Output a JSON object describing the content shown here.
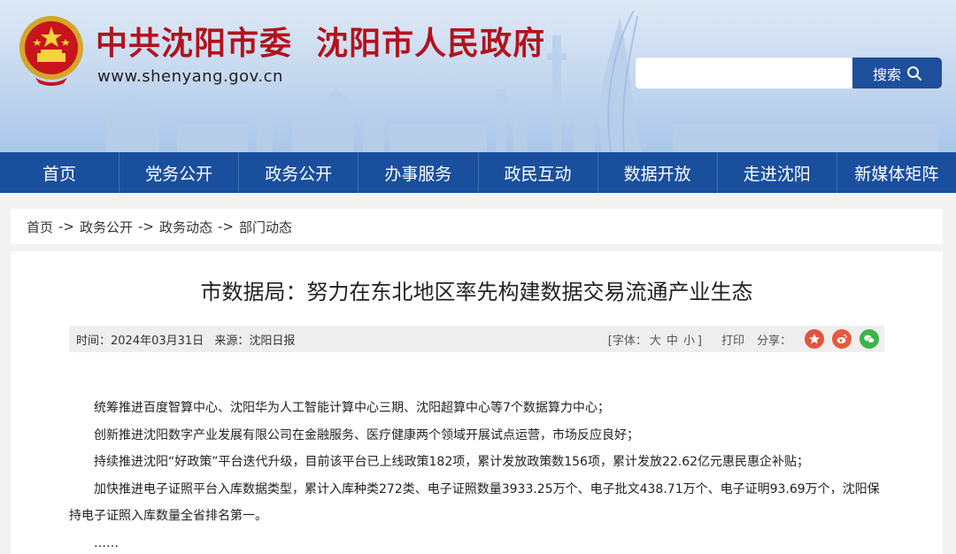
{
  "header": {
    "title": "中共沈阳市委  沈阳市人民政府",
    "url": "www.shenyang.gov.cn",
    "search_placeholder": "",
    "search_button": "搜索",
    "colors": {
      "title": "#b3121c",
      "nav": "#1a4f9d",
      "search_button": "#1d4f9c"
    }
  },
  "nav": {
    "items": [
      "首页",
      "党务公开",
      "政务公开",
      "办事服务",
      "政民互动",
      "数据开放",
      "走进沈阳",
      "新媒体矩阵"
    ]
  },
  "breadcrumb": {
    "items": [
      "首页",
      "政务公开",
      "政务动态",
      "部门动态"
    ],
    "separator": "->"
  },
  "article": {
    "title": "市数据局：努力在东北地区率先构建数据交易流通产业生态",
    "meta": {
      "time": "时间：2024年03月31日",
      "source": "来源：沈阳日报",
      "font_label_open": "[字体：",
      "font_large": "大",
      "font_medium": "中",
      "font_small": "小",
      "font_label_close": "]",
      "print": "打印",
      "share": "分享："
    },
    "share_icons": [
      "weibo-red-icon",
      "weibo-icon",
      "wechat-icon"
    ],
    "paragraphs": [
      "统筹推进百度智算中心、沈阳华为人工智能计算中心三期、沈阳超算中心等7个数据算力中心；",
      "创新推进沈阳数字产业发展有限公司在金融服务、医疗健康两个领域开展试点运营，市场反应良好；",
      "持续推进沈阳“好政策”平台迭代升级，目前该平台已上线政策182项，累计发放政策数156项，累计发放22.62亿元惠民惠企补贴；",
      "加快推进电子证照平台入库数据类型，累计入库种类272类、电子证照数量3933.25万个、电子批文438.71万个、电子证明93.69万个，沈阳保持电子证照入库数量全省排名第一。",
      "……"
    ]
  }
}
